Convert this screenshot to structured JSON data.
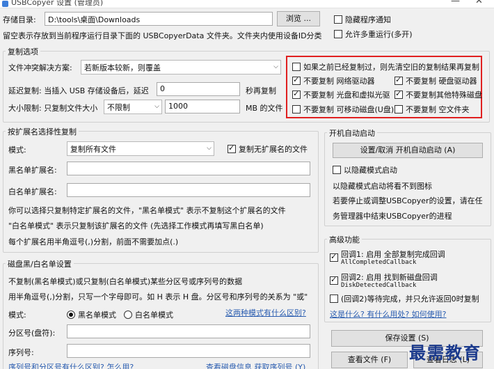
{
  "window": {
    "title": "USBCopyer 设置 (管理员)",
    "minimize": "—",
    "close": "✕"
  },
  "storage": {
    "label": "存储目录:",
    "path": "D:\\tools\\桌面\\Downloads",
    "browse": "浏览 ...",
    "hint": "留空表示存放到当前程序运行目录下面的 USBCopyerData 文件夹。文件夹内使用设备ID分类"
  },
  "top_options": {
    "hide_notify": "隐藏程序通知",
    "allow_multi": "允许多重运行(多开)"
  },
  "copy_options": {
    "title": "复制选项",
    "conflict_label": "文件冲突解决方案:",
    "conflict_value": "若新版本较新，则覆盖",
    "delay_label": "延迟复制: 当插入 USB 存储设备后，延迟",
    "delay_value": "0",
    "delay_unit": "秒再复制",
    "size_label": "大小限制: 只复制文件大小",
    "size_mode": "不限制",
    "size_value": "1000",
    "size_unit": "MB 的文件"
  },
  "drive_options": {
    "clear_prev": "如果之前已经复制过，则先清空旧的复制结果再复制",
    "no_network": "不要复制 网络驱动器",
    "no_hdd": "不要复制 硬盘驱动器",
    "no_optical": "不要复制 光盘和虚拟光驱",
    "no_special": "不要复制其他特殊磁盘",
    "no_removable": "不要复制 可移动磁盘(U盘)",
    "no_empty": "不要复制 空文件夹"
  },
  "ext_group": {
    "title": "按扩展名选择性复制",
    "mode_label": "模式:",
    "mode_value": "复制所有文件",
    "copy_noext": "复制无扩展名的文件",
    "black_label": "黑名单扩展名:",
    "white_label": "白名单扩展名:",
    "help1": "你可以选择只复制特定扩展名的文件，\"黑名单模式\" 表示不复制这个扩展名的文件",
    "help2": "\"白名单模式\" 表示只复制该扩展名的文件  (先选择工作模式再填写黑白名单)",
    "help3": "每个扩展名用半角逗号(,)分割，前面不需要加点(.)"
  },
  "disk_group": {
    "title": "磁盘黑/白名单设置",
    "help1": "不复制(黑名单模式)或只复制(白名单模式)某些分区号或序列号的数据",
    "help2": "用半角逗号(,)分割，只写一个字母即可。如 H 表示 H 盘。分区号和序列号的关系为 \"或\"",
    "mode_label": "模式:",
    "black_mode": "黑名单模式",
    "white_mode": "白名单模式",
    "diff_link": "这两种模式有什么区别?",
    "partition_label": "分区号(盘符):",
    "serial_label": "序列号:",
    "bottom_link1": "序列号和分区号有什么区别? 怎么用?",
    "bottom_link2": "查看磁盘信息 获取序列号 (Y)"
  },
  "autostart": {
    "title": "开机自动启动",
    "toggle_button": "设置/取消 开机自动启动 (A)",
    "hidden_start": "以隐藏模式启动",
    "note1": "以隐藏模式启动将看不到图标",
    "note2": "若要停止或调整USBCopyer的设置，请在任",
    "note3": "务管理器中结束USBCopyer的进程"
  },
  "advanced": {
    "title": "高级功能",
    "cb1_line1": "回调1: 启用 全部复制完成回调",
    "cb1_line2": "AllCompletedCallback",
    "cb2_line1": "回调2: 启用 找到新磁盘回调",
    "cb2_line2": "DiskDetectedCallback",
    "cb2_wait": "(回调2)等待完成，并只允许返回0时复制",
    "link": "这是什么? 有什么用处? 如何使用?"
  },
  "buttons": {
    "save": "保存设置 (S)",
    "view_files": "查看文件 (F)",
    "view_log": "查看日志 (L)"
  },
  "watermark": "最需教育",
  "colors": {
    "highlight": "#e02020",
    "link": "#2a5db0"
  }
}
